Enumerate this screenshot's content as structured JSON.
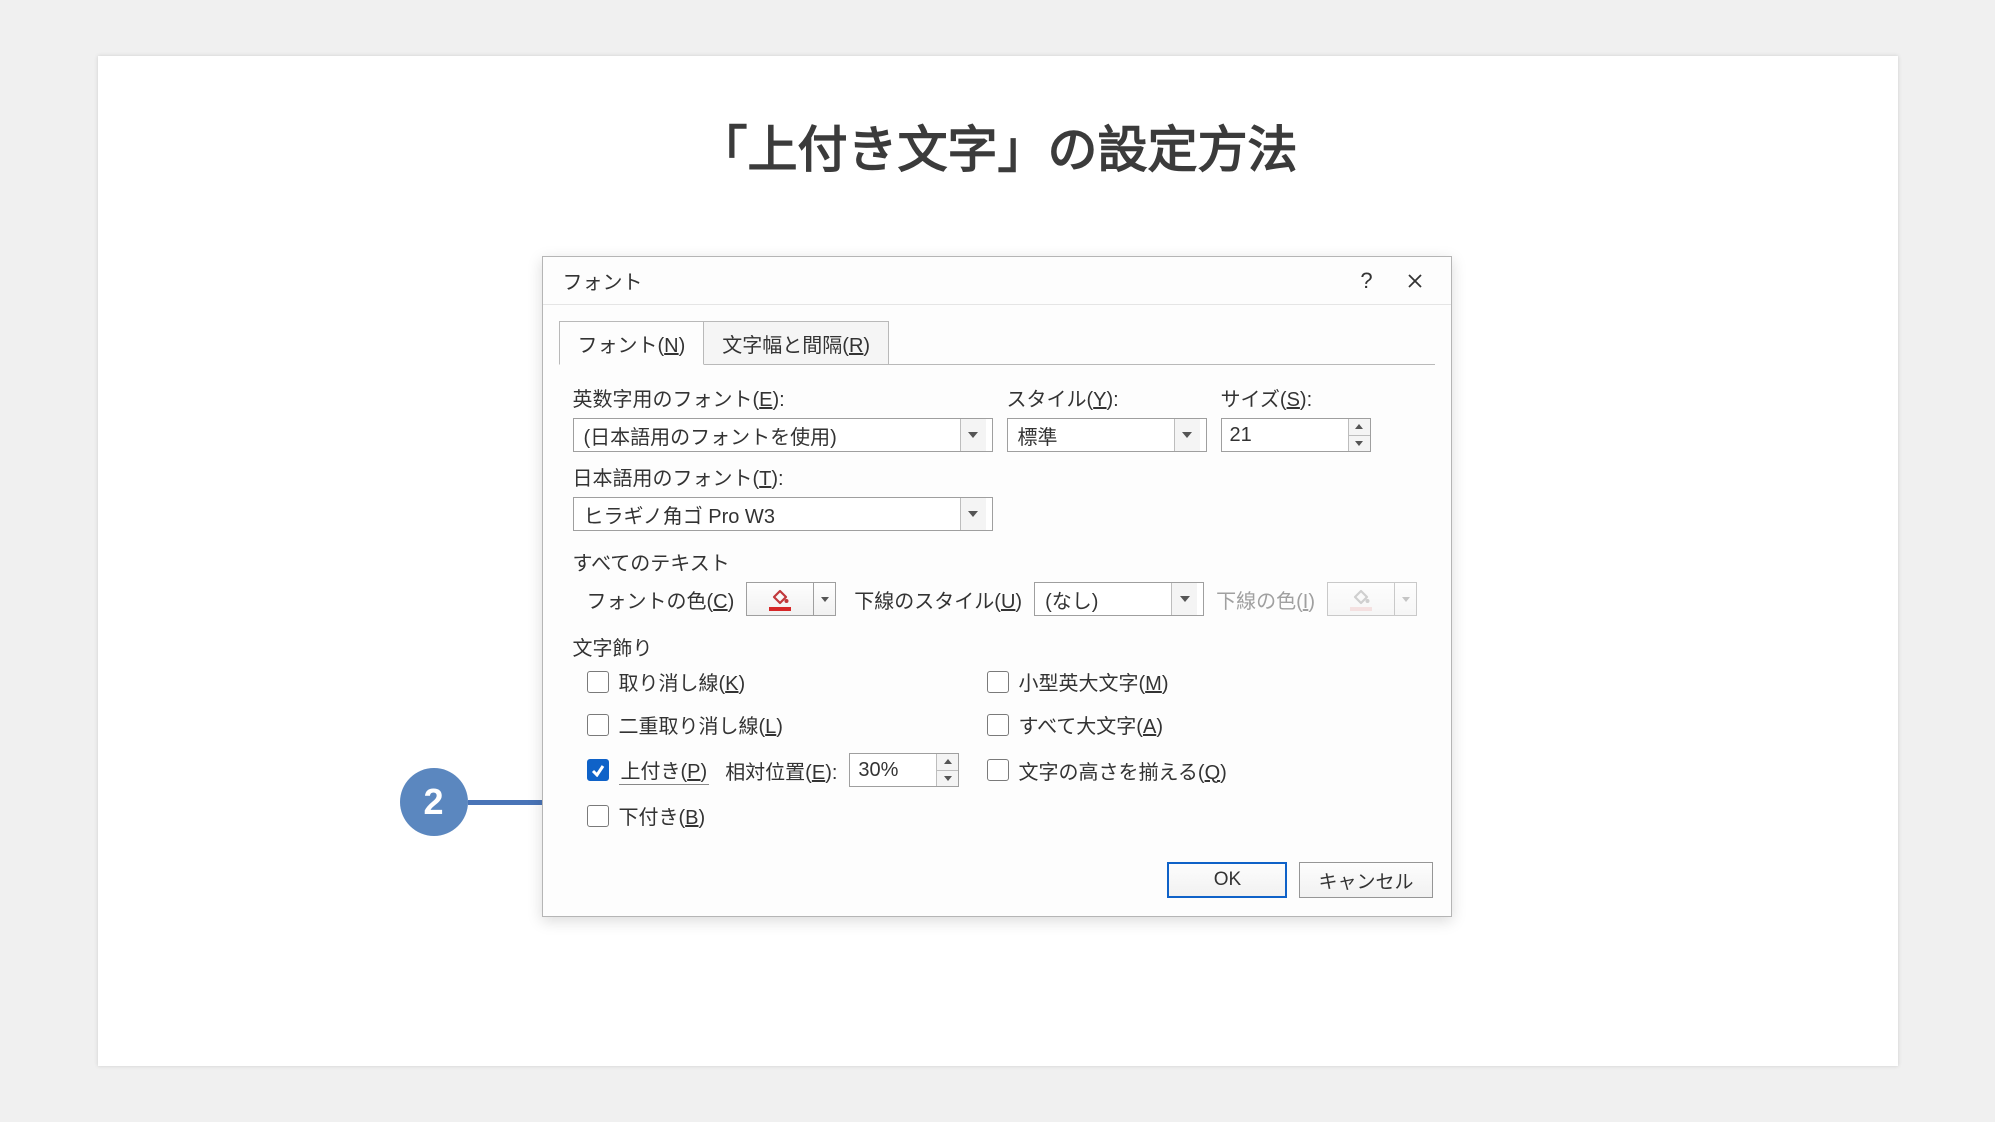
{
  "page": {
    "title": "「上付き文字」の設定方法"
  },
  "annotation": {
    "step_number": "2"
  },
  "dialog": {
    "title": "フォント",
    "help_tooltip": "?",
    "tabs": {
      "font": {
        "label": "フォント(",
        "access": "N",
        "label_end": ")"
      },
      "spacing": {
        "label": "文字幅と間隔(",
        "access": "R",
        "label_end": ")"
      }
    },
    "labels": {
      "latin_font": {
        "pre": "英数字用のフォント(",
        "access": "E",
        "post": "):"
      },
      "asian_font": {
        "pre": "日本語用のフォント(",
        "access": "T",
        "post": "):"
      },
      "style": {
        "pre": "スタイル(",
        "access": "Y",
        "post": "):"
      },
      "size": {
        "pre": "サイズ(",
        "access": "S",
        "post": "):"
      },
      "all_text": "すべてのテキスト",
      "font_color": {
        "pre": "フォントの色(",
        "access": "C",
        "post": ")"
      },
      "underline_style": {
        "pre": "下線のスタイル(",
        "access": "U",
        "post": ")"
      },
      "underline_color": {
        "pre": "下線の色(",
        "access": "I",
        "post": ")"
      },
      "effects": "文字飾り"
    },
    "values": {
      "latin_font": "(日本語用のフォントを使用)",
      "asian_font": "ヒラギノ角ゴ Pro W3",
      "style": "標準",
      "size": "21",
      "underline_style": "(なし)"
    },
    "effects": {
      "strikethrough": {
        "pre": "取り消し線(",
        "access": "K",
        "post": ")"
      },
      "double_strike": {
        "pre": "二重取り消し線(",
        "access": "L",
        "post": ")"
      },
      "superscript": {
        "pre": "上付き(",
        "access": "P",
        "post": ")"
      },
      "rel_position": {
        "pre": "相対位置(",
        "access": "E",
        "post": "):"
      },
      "rel_position_value": "30%",
      "subscript": {
        "pre": "下付き(",
        "access": "B",
        "post": ")"
      },
      "small_caps": {
        "pre": "小型英大文字(",
        "access": "M",
        "post": ")"
      },
      "all_caps": {
        "pre": "すべて大文字(",
        "access": "A",
        "post": ")"
      },
      "equalize": {
        "pre": "文字の高さを揃える(",
        "access": "Q",
        "post": ")"
      }
    },
    "buttons": {
      "ok": "OK",
      "cancel": "キャンセル"
    }
  }
}
